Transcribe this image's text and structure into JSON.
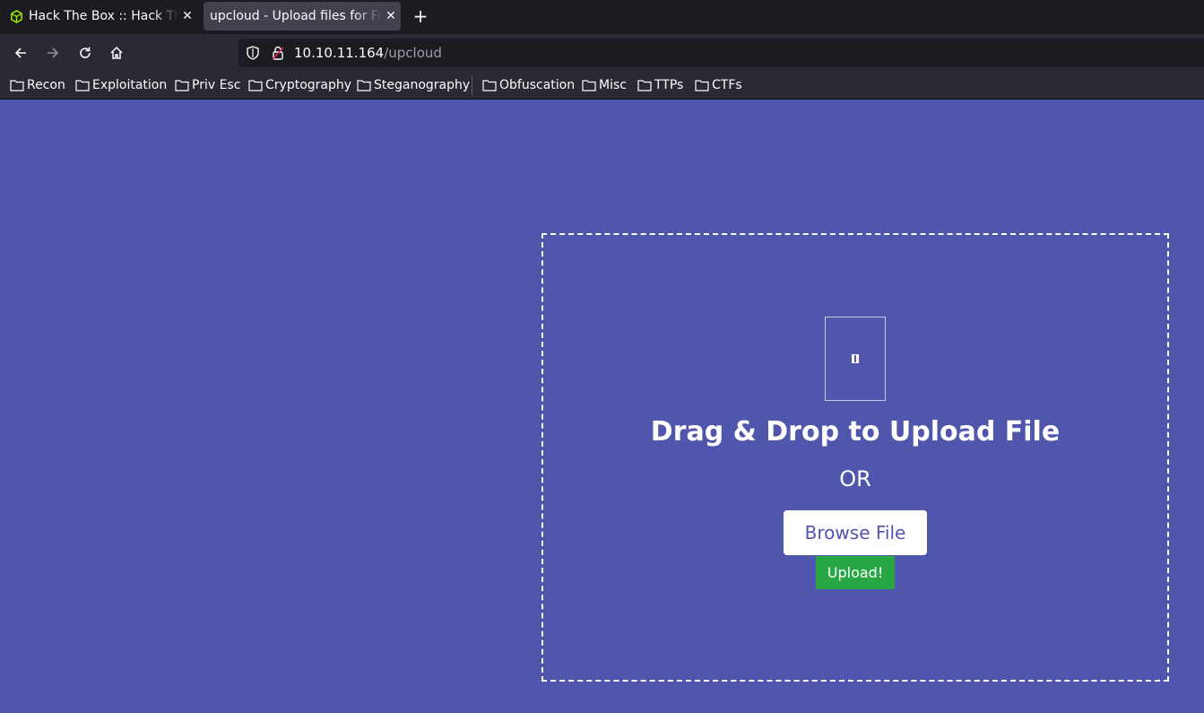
{
  "browser": {
    "tabs": [
      {
        "label": "Hack The Box :: Hack The Box",
        "close": "✕"
      },
      {
        "label": "upcloud - Upload files for Free!",
        "close": "✕"
      }
    ],
    "new_tab": "+",
    "url": {
      "host": "10.10.11.164",
      "path": "/upcloud"
    },
    "bookmarks": [
      "Recon",
      "Exploitation",
      "Priv Esc",
      "Cryptography",
      "Steganography",
      "Obfuscation",
      "Misc",
      "TTPs",
      "CTFs"
    ]
  },
  "page": {
    "title": "Drag & Drop to Upload File",
    "or": "OR",
    "browse_label": "Browse File",
    "upload_label": "Upload!"
  },
  "colors": {
    "page_bg": "#5156ad",
    "upload_green": "#28a745",
    "htb_green": "#9fef00"
  },
  "icons": [
    "htb-cube-icon",
    "back-arrow-icon",
    "forward-arrow-icon",
    "reload-icon",
    "home-icon",
    "shield-icon",
    "insecure-lock-icon",
    "folder-icon",
    "file-icon"
  ]
}
